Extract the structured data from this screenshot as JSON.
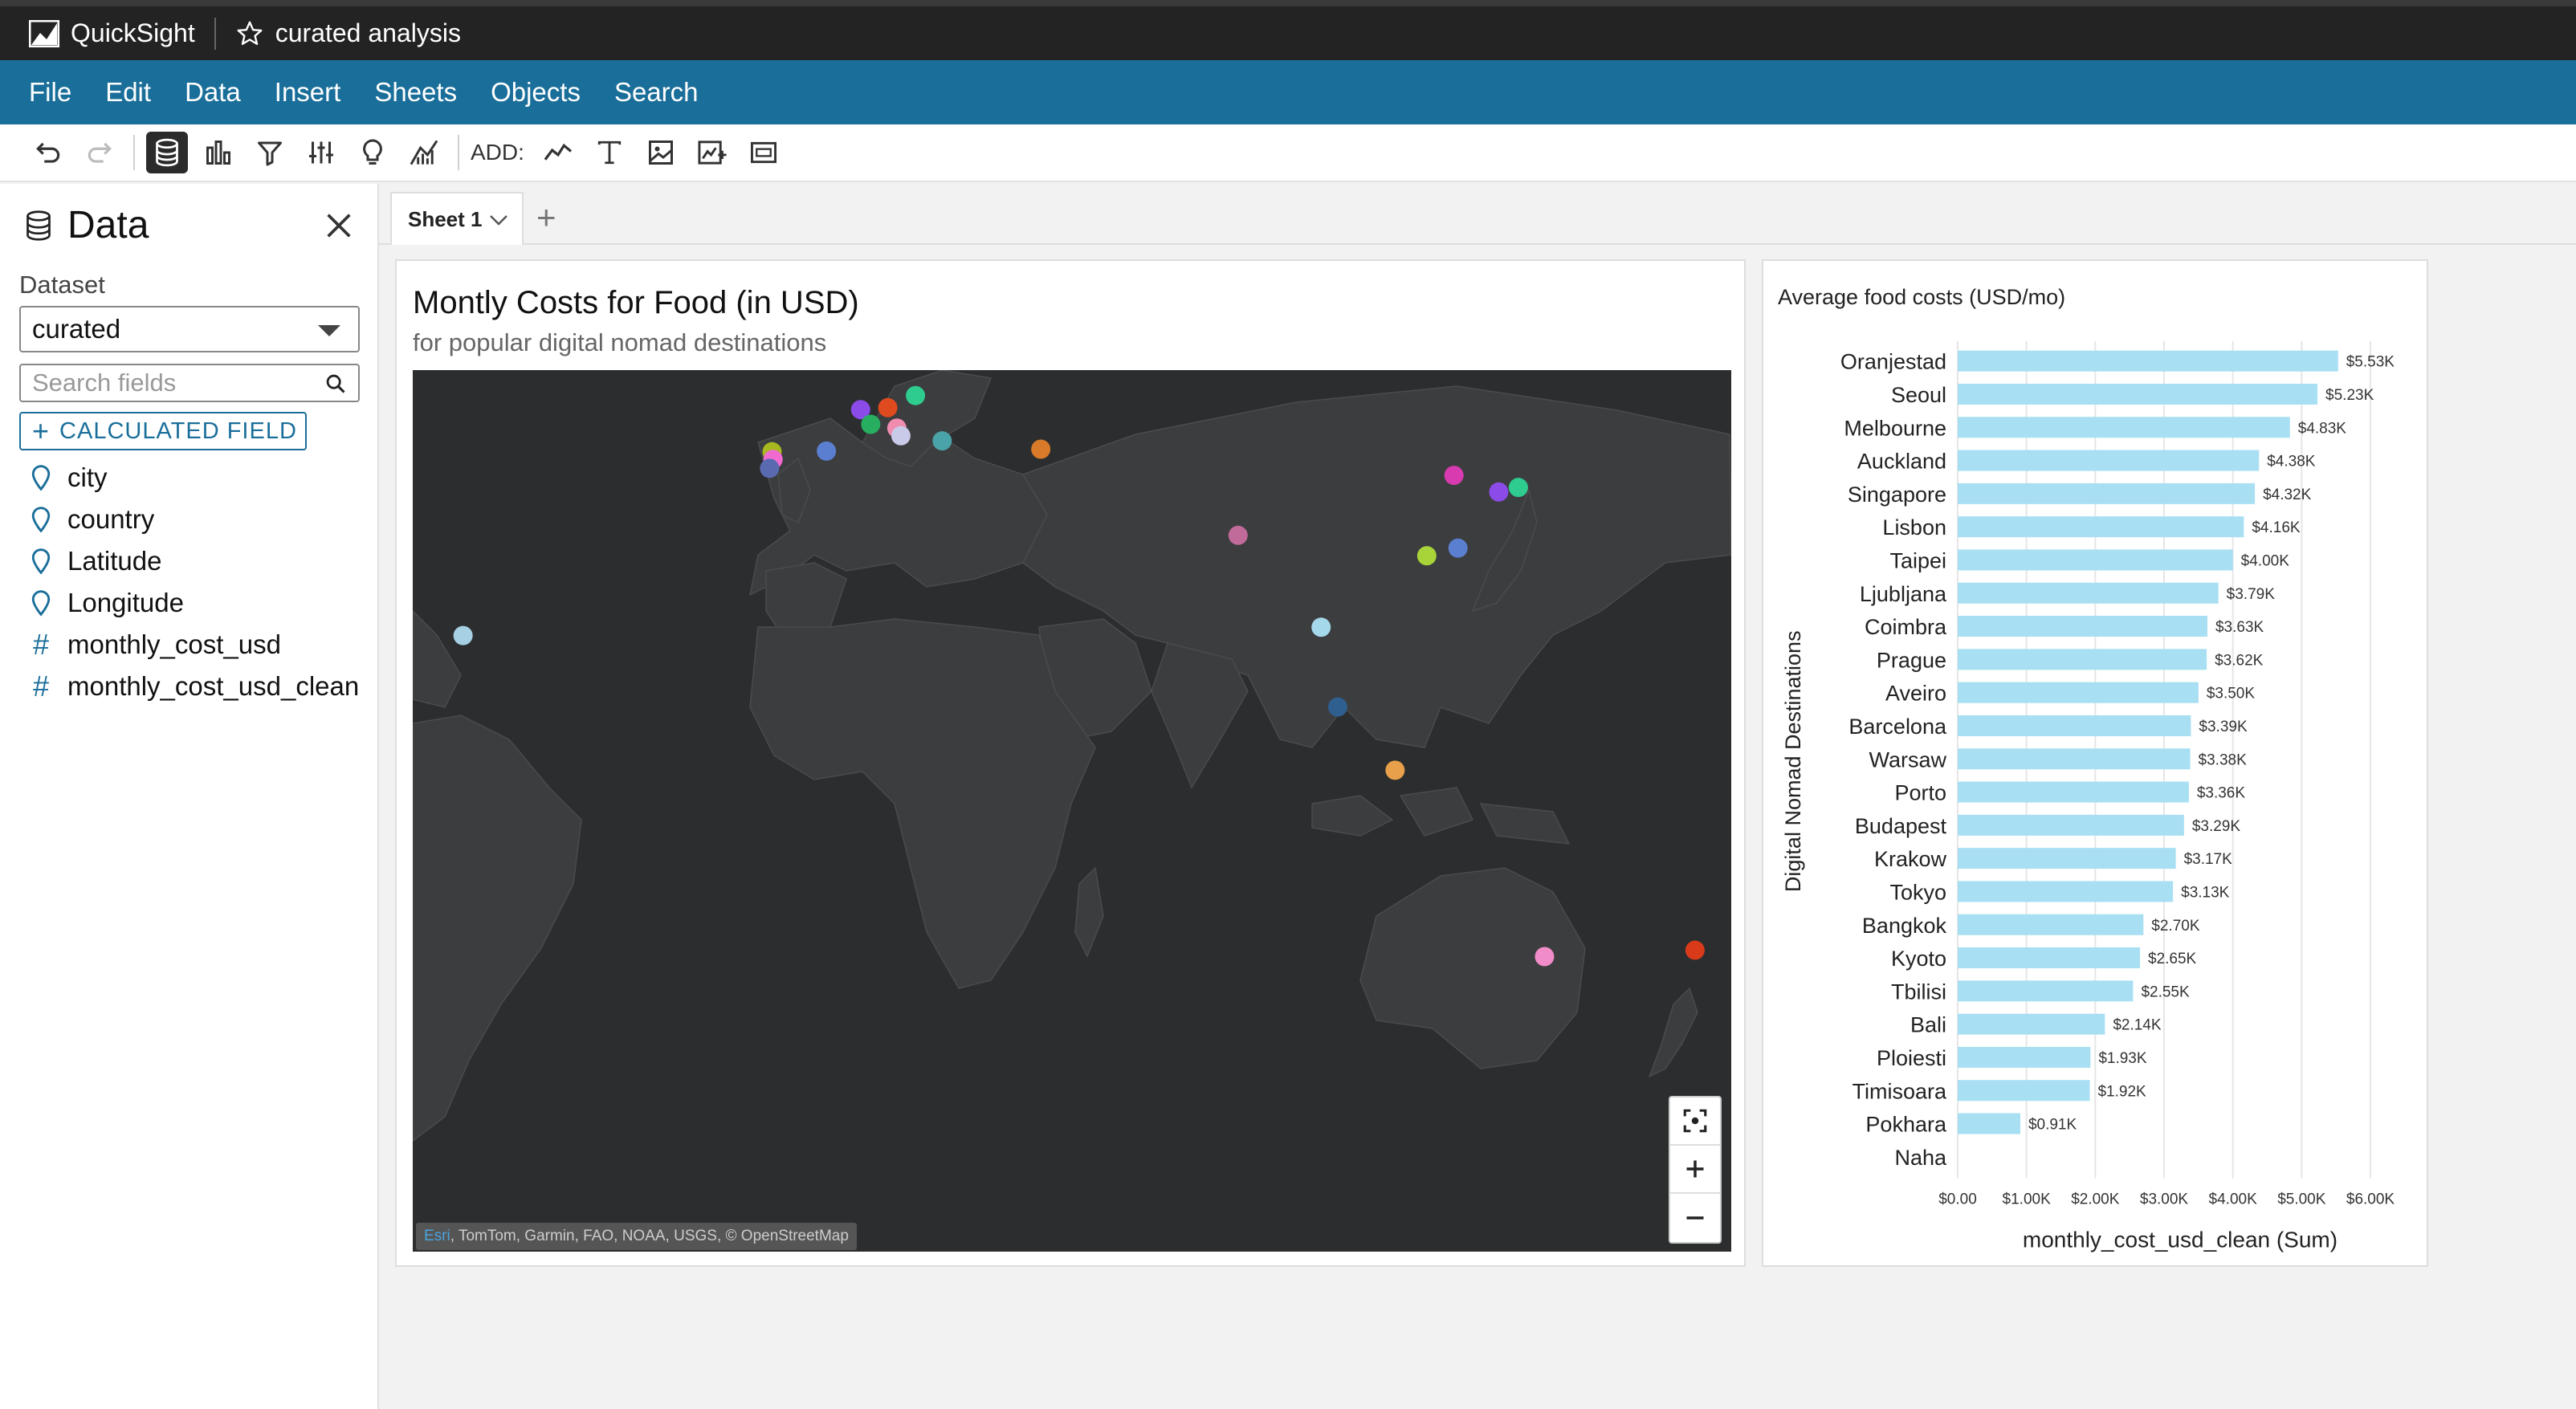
{
  "app": {
    "product_name": "QuickSight",
    "analysis_name": "curated analysis"
  },
  "menu": [
    "File",
    "Edit",
    "Data",
    "Insert",
    "Sheets",
    "Objects",
    "Search"
  ],
  "toolbar": {
    "add_label": "ADD:",
    "icons": [
      "undo-icon",
      "redo-icon",
      "dataset-icon",
      "visualize-icon",
      "filter-icon",
      "parameters-icon",
      "insights-icon",
      "ml-insights-icon",
      "add-line-chart-icon",
      "add-text-icon",
      "add-image-icon",
      "add-insight-icon",
      "add-embed-icon"
    ]
  },
  "data_panel": {
    "title": "Data",
    "dataset_label": "Dataset",
    "dataset_value": "curated",
    "search_placeholder": "Search fields",
    "calculated_field_label": "CALCULATED FIELD",
    "fields": [
      {
        "name": "city",
        "type": "geo"
      },
      {
        "name": "country",
        "type": "geo"
      },
      {
        "name": "Latitude",
        "type": "geo"
      },
      {
        "name": "Longitude",
        "type": "geo"
      },
      {
        "name": "monthly_cost_usd",
        "type": "measure"
      },
      {
        "name": "monthly_cost_usd_clean",
        "type": "measure"
      }
    ]
  },
  "sheets": {
    "active": "Sheet 1",
    "add_label": "+"
  },
  "map_visual": {
    "title": "Montly Costs for Food (in USD)",
    "subtitle": "for popular digital nomad destinations",
    "attribution_link": "Esri",
    "attribution_text": ", TomTom, Garmin, FAO, NOAA, USGS, © OpenStreetMap",
    "controls": [
      "fit-bounds-icon",
      "zoom-in-icon",
      "zoom-out-icon"
    ],
    "points": [
      {
        "lon": 9.0,
        "lat": 47.9,
        "color": "#8a4be8"
      },
      {
        "lon": 19.9,
        "lat": 50.1,
        "color": "#2ecc8f"
      },
      {
        "lon": 14.4,
        "lat": 48.2,
        "color": "#e04a1f"
      },
      {
        "lon": 11.0,
        "lat": 45.6,
        "color": "#27ae60"
      },
      {
        "lon": 16.2,
        "lat": 45.0,
        "color": "#f08cb0"
      },
      {
        "lon": 17.0,
        "lat": 43.8,
        "color": "#c9c9e8"
      },
      {
        "lon": 25.2,
        "lat": 43.0,
        "color": "#4aa3a8"
      },
      {
        "lon": -8.6,
        "lat": 41.3,
        "color": "#a8b820"
      },
      {
        "lon": -8.4,
        "lat": 40.1,
        "color": "#f06ad0"
      },
      {
        "lon": -9.1,
        "lat": 38.7,
        "color": "#5a6ab0"
      },
      {
        "lon": 2.2,
        "lat": 41.4,
        "color": "#5b7fd0"
      },
      {
        "lon": 44.8,
        "lat": 41.7,
        "color": "#d97a2a"
      },
      {
        "lon": 84.0,
        "lat": 28.2,
        "color": "#c06b9a"
      },
      {
        "lon": 126.9,
        "lat": 37.6,
        "color": "#d83bb0"
      },
      {
        "lon": 135.8,
        "lat": 35.0,
        "color": "#8a4be8"
      },
      {
        "lon": 139.7,
        "lat": 35.7,
        "color": "#2ecc8f"
      },
      {
        "lon": 121.5,
        "lat": 25.0,
        "color": "#a8d43a"
      },
      {
        "lon": 127.7,
        "lat": 26.2,
        "color": "#5b7fd0"
      },
      {
        "lon": 100.5,
        "lat": 13.8,
        "color": "#a6d8ec"
      },
      {
        "lon": 103.8,
        "lat": 1.3,
        "color": "#2f5f8f"
      },
      {
        "lon": 115.2,
        "lat": -8.6,
        "color": "#e8a04a"
      },
      {
        "lon": 144.9,
        "lat": -37.8,
        "color": "#f08cc8"
      },
      {
        "lon": 174.8,
        "lat": -36.8,
        "color": "#d83a1a"
      },
      {
        "lon": -70.0,
        "lat": 12.5,
        "color": "#a6d0e4"
      }
    ]
  },
  "chart_data": {
    "type": "bar",
    "title": "Average food costs (USD/mo)",
    "xlabel": "monthly_cost_usd_clean (Sum)",
    "ylabel": "Digital Nomad Destinations",
    "orientation": "horizontal",
    "categories": [
      "Oranjestad",
      "Seoul",
      "Melbourne",
      "Auckland",
      "Singapore",
      "Lisbon",
      "Taipei",
      "Ljubljana",
      "Coimbra",
      "Prague",
      "Aveiro",
      "Barcelona",
      "Warsaw",
      "Porto",
      "Budapest",
      "Krakow",
      "Tokyo",
      "Bangkok",
      "Kyoto",
      "Tbilisi",
      "Bali",
      "Ploiesti",
      "Timisoara",
      "Pokhara",
      "Naha"
    ],
    "values": [
      5.53,
      5.23,
      4.83,
      4.38,
      4.32,
      4.16,
      4.0,
      3.79,
      3.63,
      3.62,
      3.5,
      3.39,
      3.38,
      3.36,
      3.29,
      3.17,
      3.13,
      2.7,
      2.65,
      2.55,
      2.14,
      1.93,
      1.92,
      0.91,
      0
    ],
    "value_labels": [
      "$5.53K",
      "$5.23K",
      "$4.83K",
      "$4.38K",
      "$4.32K",
      "$4.16K",
      "$4.00K",
      "$3.79K",
      "$3.63K",
      "$3.62K",
      "$3.50K",
      "$3.39K",
      "$3.38K",
      "$3.36K",
      "$3.29K",
      "$3.17K",
      "$3.13K",
      "$2.70K",
      "$2.65K",
      "$2.55K",
      "$2.14K",
      "$1.93K",
      "$1.92K",
      "$0.91K",
      ""
    ],
    "unit": "thousands USD",
    "xlim": [
      0,
      6
    ],
    "x_ticks": [
      "$0.00",
      "$1.00K",
      "$2.00K",
      "$3.00K",
      "$4.00K",
      "$5.00K",
      "$6.00K"
    ],
    "bar_color": "#a8dff2",
    "grid": true
  }
}
